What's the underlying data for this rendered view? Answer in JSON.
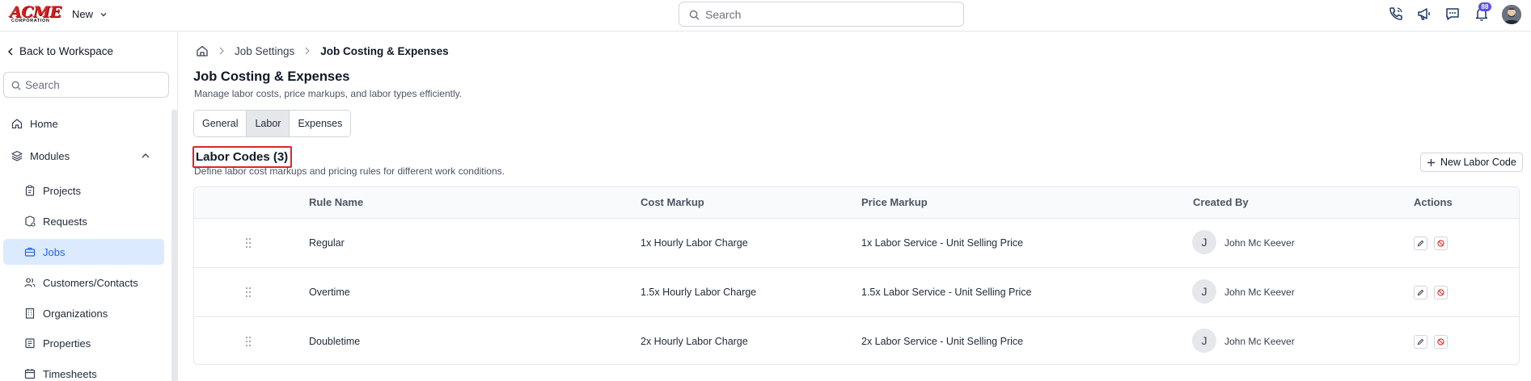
{
  "topbar": {
    "logo_text": "ACME",
    "logo_sub": "CORPORATION",
    "new_label": "New",
    "search_placeholder": "Search",
    "notification_count": "88",
    "icons": [
      "phone-icon",
      "megaphone-icon",
      "chat-icon",
      "bell-icon",
      "user-avatar"
    ]
  },
  "sidebar": {
    "back_label": "Back to Workspace",
    "search_placeholder": "Search",
    "items": [
      {
        "label": "Home",
        "icon": "home-icon"
      },
      {
        "label": "Modules",
        "icon": "layers-icon"
      },
      {
        "label": "Projects",
        "icon": "clipboard-icon"
      },
      {
        "label": "Requests",
        "icon": "request-icon"
      },
      {
        "label": "Jobs",
        "icon": "briefcase-icon",
        "active": true
      },
      {
        "label": "Customers/Contacts",
        "icon": "users-icon"
      },
      {
        "label": "Organizations",
        "icon": "building-icon"
      },
      {
        "label": "Properties",
        "icon": "property-icon"
      },
      {
        "label": "Timesheets",
        "icon": "calendar-icon"
      }
    ]
  },
  "breadcrumb": {
    "items": [
      "Job Settings",
      "Job Costing & Expenses"
    ]
  },
  "page": {
    "title": "Job Costing & Expenses",
    "subtitle": "Manage labor costs, price markups, and labor types efficiently."
  },
  "tabs": [
    "General",
    "Labor",
    "Expenses"
  ],
  "active_tab": "Labor",
  "section": {
    "title": "Labor Codes (3)",
    "subtitle": "Define labor cost markups and pricing rules for different work conditions.",
    "new_button": "New Labor Code"
  },
  "table": {
    "headers": [
      "Rule Name",
      "Cost Markup",
      "Price Markup",
      "Created By",
      "Actions"
    ],
    "rows": [
      {
        "rule": "Regular",
        "cost": "1x Hourly Labor Charge",
        "price": "1x Labor Service - Unit Selling Price",
        "initial": "J",
        "creator": "John Mc Keever"
      },
      {
        "rule": "Overtime",
        "cost": "1.5x Hourly Labor Charge",
        "price": "1.5x Labor Service - Unit Selling Price",
        "initial": "J",
        "creator": "John Mc Keever"
      },
      {
        "rule": "Doubletime",
        "cost": "2x Hourly Labor Charge",
        "price": "2x Labor Service - Unit Selling Price",
        "initial": "J",
        "creator": "John Mc Keever"
      }
    ]
  },
  "colors": {
    "accent": "#2563eb",
    "active_bg": "#dbeafe",
    "danger": "#dc2626",
    "logo_red": "#d81e1e",
    "badge": "#5b4ee8"
  }
}
